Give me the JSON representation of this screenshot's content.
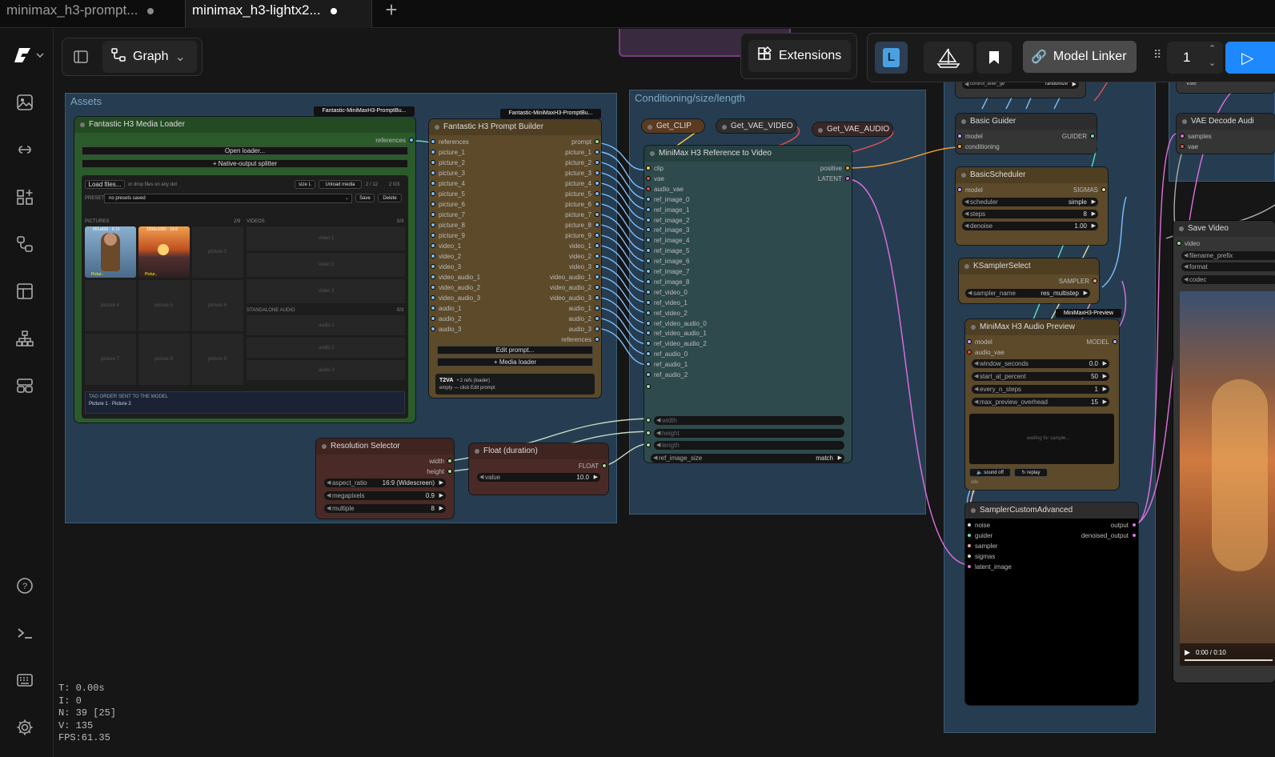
{
  "tabs": [
    {
      "label": "minimax_h3-prompt...",
      "active": false
    },
    {
      "label": "minimax_h3-lightx2...",
      "active": true
    }
  ],
  "new_tab_icon": "plus-icon",
  "toolbar": {
    "view_mode": "Graph",
    "extensions": "Extensions",
    "model_linker": "Model Linker",
    "queue_count": "1"
  },
  "rail_icons": [
    "logo-icon",
    "images-icon",
    "models-icon",
    "nodes-icon",
    "workflows-icon",
    "templates-icon",
    "hierarchy-icon",
    "layout-icon",
    "help-icon",
    "terminal-icon",
    "keyboard-icon",
    "settings-icon"
  ],
  "groups": {
    "assets": "Assets",
    "conditioning": "Conditioning/size/length"
  },
  "media_loader": {
    "title": "Fantastic H3 Media Loader",
    "badge": "Fantastic-MiniMaxH3-PromptBu...",
    "output": "references",
    "open_loader": "Open loader...",
    "native_splitter": "+ Native-output splitter",
    "load_files": "Load files...",
    "drop_hint": "or drop files on any dot",
    "size": "size L",
    "unload": "Unload media",
    "count1": "2 / 12",
    "count2": "2 0/3",
    "preset_label": "PRESET",
    "preset_value": "no presets saved",
    "save": "Save",
    "delete": "Delete",
    "pictures_label": "PICTURES",
    "pictures_count": "2/9",
    "videos_label": "VIDEOS",
    "videos_count": "0/3",
    "thumb1_size": "851x836 · 5:16",
    "thumb2_size": "1936x1080 · 16:9",
    "thumb_tag": "Pictur..",
    "picture_slots": [
      "picture 3",
      "picture 4",
      "picture 5",
      "picture 6",
      "picture 7",
      "picture 8",
      "picture 9"
    ],
    "video_slots": [
      "video 1",
      "video 2",
      "video 3"
    ],
    "audio_label": "STANDALONE AUDIO",
    "audio_count": "0/3",
    "audio_slots": [
      "audio 1",
      "audio 2",
      "audio 3"
    ],
    "tag_order_title": "TAG ORDER SENT TO THE MODEL",
    "tag_order": "Picture 1 · Picture 2"
  },
  "prompt_builder": {
    "title": "Fantastic H3 Prompt Builder",
    "badge": "Fantastic-MiniMaxH3-PromptBu...",
    "inputs": [
      "references",
      "picture_1",
      "picture_2",
      "picture_3",
      "picture_4",
      "picture_5",
      "picture_6",
      "picture_7",
      "picture_8",
      "picture_9",
      "video_1",
      "video_2",
      "video_3",
      "video_audio_1",
      "video_audio_2",
      "video_audio_3",
      "audio_1",
      "audio_2",
      "audio_3"
    ],
    "outputs": [
      "prompt",
      "picture_1",
      "picture_2",
      "picture_3",
      "picture_4",
      "picture_5",
      "picture_6",
      "picture_7",
      "picture_8",
      "picture_9",
      "video_1",
      "video_2",
      "video_3",
      "video_audio_1",
      "video_audio_2",
      "video_audio_3",
      "audio_1",
      "audio_2",
      "audio_3",
      "references"
    ],
    "edit_prompt": "Edit prompt...",
    "media_loader": "+ Media loader",
    "mode": "T2VA",
    "mode_info": "• 2 refs (loader)",
    "empty_hint": "empty — click Edit prompt"
  },
  "getters": [
    "Get_CLIP",
    "Get_VAE_VIDEO",
    "Get_VAE_AUDIO"
  ],
  "ref_to_video": {
    "title": "MiniMax H3 Reference to Video",
    "inputs": [
      "clip",
      "vae",
      "audio_vae",
      "ref_image_0",
      "ref_image_1",
      "ref_image_2",
      "ref_image_3",
      "ref_image_4",
      "ref_image_5",
      "ref_image_6",
      "ref_image_7",
      "ref_image_8",
      "ref_video_0",
      "ref_video_1",
      "ref_video_2",
      "ref_video_audio_0",
      "ref_video_audio_1",
      "ref_video_audio_2",
      "ref_audio_0",
      "ref_audio_1",
      "ref_audio_2"
    ],
    "outputs": [
      "positive",
      "LATENT"
    ],
    "widget_inputs": [
      "width",
      "height",
      "length"
    ],
    "ref_image_size": "ref_image_size",
    "ref_image_size_value": "match"
  },
  "resolution_selector": {
    "title": "Resolution Selector",
    "outputs": [
      "width",
      "height"
    ],
    "widgets": [
      {
        "label": "aspect_ratio",
        "value": "16:9 (Widescreen)"
      },
      {
        "label": "megapixels",
        "value": "0.9"
      },
      {
        "label": "multiple",
        "value": "8"
      }
    ]
  },
  "float_duration": {
    "title": "Float (duration)",
    "output": "FLOAT",
    "widget": {
      "label": "value",
      "value": "10.0"
    }
  },
  "basic_guider": {
    "title": "Basic Guider",
    "inputs": [
      "model",
      "conditioning"
    ],
    "output": "GUIDER"
  },
  "basic_scheduler": {
    "title": "BasicScheduler",
    "input": "model",
    "output": "SIGMAS",
    "widgets": [
      {
        "label": "scheduler",
        "value": "simple"
      },
      {
        "label": "steps",
        "value": "8"
      },
      {
        "label": "denoise",
        "value": "1.00"
      }
    ]
  },
  "ksampler_select": {
    "title": "KSamplerSelect",
    "output": "SAMPLER",
    "widget": {
      "label": "sampler_name",
      "value": "res_multistep"
    }
  },
  "audio_preview": {
    "title": "MiniMax H3 Audio Preview",
    "badge": "MiniMaxH3-Preview",
    "inputs": [
      "model",
      "audio_vae"
    ],
    "output": "MODEL",
    "widgets": [
      {
        "label": "window_seconds",
        "value": "0.0"
      },
      {
        "label": "start_at_percent",
        "value": "50"
      },
      {
        "label": "every_n_steps",
        "value": "1"
      },
      {
        "label": "max_preview_overhead",
        "value": "15"
      }
    ],
    "waiting": "waiting for sample...",
    "sound_off": "sound off",
    "replay": "replay",
    "idle": "idle"
  },
  "sampler_custom": {
    "title": "SamplerCustomAdvanced",
    "inputs": [
      "noise",
      "guider",
      "sampler",
      "sigmas",
      "latent_image"
    ],
    "outputs": [
      "output",
      "denoised_output"
    ]
  },
  "vae_decode": {
    "title": "VAE Decode Audi",
    "inputs": [
      "samples",
      "vae"
    ],
    "top_stub": "vae",
    "stub_title": "Get_VAE_VIDEO"
  },
  "save_video": {
    "title": "Save Video",
    "input": "video",
    "widgets": [
      "filename_prefix",
      "format",
      "codec"
    ],
    "time": "0:00 / 0:10"
  },
  "top_stub": {
    "label": "control_after_ge",
    "value": "randomize"
  },
  "stats": [
    "T: 0.00s",
    "I: 0",
    "N: 39 [25]",
    "V: 135",
    "FPS:61.35"
  ],
  "colors": {
    "green_node": "#2b5a2b",
    "brown_node": "#5c4a2a",
    "teal_node": "#2e4a4d",
    "dark_node": "#353535",
    "red_node": "#4a2a26",
    "accent": "#1e88ff",
    "wire_orange": "#f0a030",
    "wire_pink": "#e070e0",
    "wire_blue": "#7ec0ff",
    "wire_teal": "#60e0c0"
  }
}
